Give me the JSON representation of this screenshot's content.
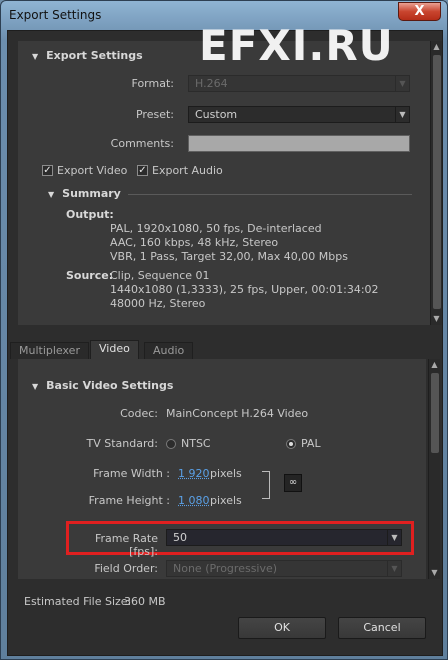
{
  "window": {
    "title": "Export Settings",
    "close_label": "X"
  },
  "watermark": "EFXI.RU",
  "export_settings": {
    "heading": "Export Settings",
    "format_label": "Format:",
    "format_value": "H.264",
    "preset_label": "Preset:",
    "preset_value": "Custom",
    "comments_label": "Comments:",
    "comments_value": "",
    "export_video_label": "Export Video",
    "export_video_checked": true,
    "export_audio_label": "Export Audio",
    "export_audio_checked": true
  },
  "summary": {
    "heading": "Summary",
    "output_label": "Output:",
    "output_lines": [
      "PAL, 1920x1080, 50 fps, De-interlaced",
      "AAC, 160 kbps, 48 kHz, Stereo",
      "VBR, 1 Pass, Target 32,00, Max 40,00 Mbps"
    ],
    "source_label": "Source:",
    "source_lines": [
      "Clip, Sequence 01",
      "1440x1080 (1,3333), 25 fps, Upper, 00:01:34:02",
      "48000 Hz, Stereo"
    ]
  },
  "tabs": [
    {
      "label": "Multiplexer",
      "active": false
    },
    {
      "label": "Video",
      "active": true
    },
    {
      "label": "Audio",
      "active": false
    }
  ],
  "basic_video": {
    "heading": "Basic Video Settings",
    "codec_label": "Codec:",
    "codec_value": "MainConcept H.264 Video",
    "tv_standard_label": "TV Standard:",
    "ntsc_label": "NTSC",
    "pal_label": "PAL",
    "tv_standard_selected": "PAL",
    "frame_width_label": "Frame Width :",
    "frame_width_value": "1 920",
    "frame_height_label": "Frame Height :",
    "frame_height_value": "1 080",
    "pixels_label": "pixels",
    "frame_rate_label": "Frame Rate [fps]:",
    "frame_rate_value": "50",
    "field_order_label": "Field Order:",
    "field_order_value": "None (Progressive)"
  },
  "footer": {
    "file_size_label": "Estimated File Size:",
    "file_size_value": "360 MB",
    "ok_label": "OK",
    "cancel_label": "Cancel"
  },
  "colors": {
    "highlight": "#e02020",
    "link": "#5aa0e6"
  }
}
